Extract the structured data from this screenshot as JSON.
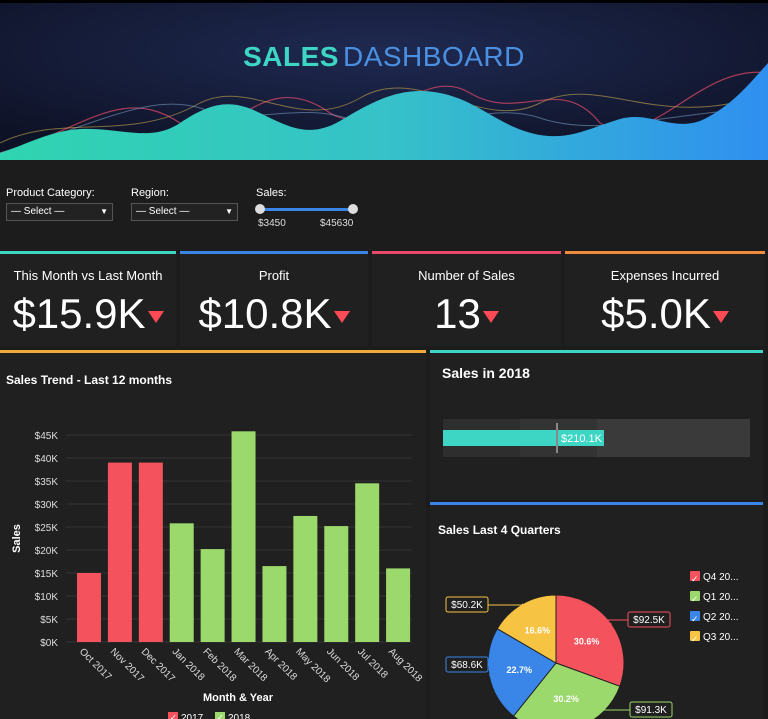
{
  "header": {
    "title_part1": "SALES",
    "title_part2": "DASHBOARD"
  },
  "filters": {
    "product_category": {
      "label": "Product Category:",
      "value": "— Select —"
    },
    "region": {
      "label": "Region:",
      "value": "— Select —"
    },
    "sales": {
      "label": "Sales:",
      "min": "$3450",
      "max": "$45630"
    }
  },
  "kpis": [
    {
      "title": "This Month vs Last Month",
      "value": "$15.9K",
      "color": "#3dd6c5"
    },
    {
      "title": "Profit",
      "value": "$10.8K",
      "color": "#3a86e8"
    },
    {
      "title": "Number of Sales",
      "value": "13",
      "color": "#e84a6a"
    },
    {
      "title": "Expenses Incurred",
      "value": "$5.0K",
      "color": "#f08a3c"
    }
  ],
  "sales_trend": {
    "title": "Sales Trend - Last 12 months",
    "xlabel": "Month & Year",
    "ylabel": "Sales",
    "legend": [
      "2017",
      "2018"
    ]
  },
  "sales_2018": {
    "title": "Sales in 2018",
    "value_label": "$210.1K"
  },
  "quarters": {
    "title": "Sales Last 4 Quarters",
    "legend": [
      "Q4 20...",
      "Q1 20...",
      "Q2 20...",
      "Q3 20..."
    ]
  },
  "chart_data": [
    {
      "type": "bar",
      "title": "Sales Trend - Last 12 months",
      "xlabel": "Month & Year",
      "ylabel": "Sales",
      "categories": [
        "Oct 2017",
        "Nov 2017",
        "Dec 2017",
        "Jan 2018",
        "Feb 2018",
        "Mar 2018",
        "Apr 2018",
        "May 2018",
        "Jun 2018",
        "Jul 2018",
        "Aug 2018"
      ],
      "values": [
        15000,
        39000,
        39000,
        25800,
        20200,
        45800,
        16500,
        27400,
        25200,
        34500,
        16000
      ],
      "year": [
        "2017",
        "2017",
        "2017",
        "2018",
        "2018",
        "2018",
        "2018",
        "2018",
        "2018",
        "2018",
        "2018"
      ],
      "ylim": [
        0,
        45000
      ],
      "yticks": [
        "$0K",
        "$5K",
        "$10K",
        "$15K",
        "$20K",
        "$25K",
        "$30K",
        "$35K",
        "$40K",
        "$45K"
      ],
      "legend_placement": "bottom",
      "colors": {
        "2017": "#f4535e",
        "2018": "#9bd96c"
      }
    },
    {
      "type": "bar",
      "title": "Sales in 2018",
      "orientation": "horizontal",
      "values": [
        210.1
      ],
      "value_label": "$210.1K"
    },
    {
      "type": "pie",
      "title": "Sales Last 4 Quarters",
      "categories": [
        "Q4 20...",
        "Q1 20...",
        "Q2 20...",
        "Q3 20..."
      ],
      "values": [
        30.6,
        30.2,
        22.7,
        16.6
      ],
      "percent_labels": [
        "30.6%",
        "30.2%",
        "22.7%",
        "16.6%"
      ],
      "value_labels": [
        "$92.5K",
        "$91.3K",
        "$68.6K",
        "$50.2K"
      ],
      "colors": [
        "#f4535e",
        "#9bd96c",
        "#3a86e8",
        "#f6c343"
      ],
      "legend_placement": "right"
    }
  ]
}
